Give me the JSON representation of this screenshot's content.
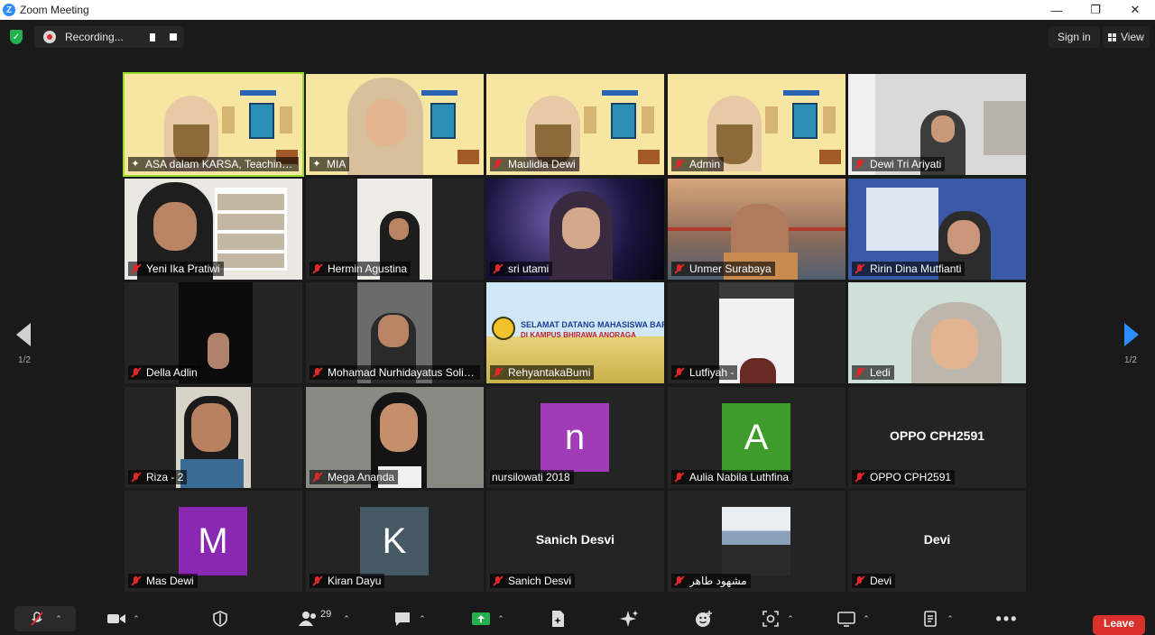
{
  "window": {
    "title": "Zoom Meeting",
    "minimize": "—",
    "restore": "❐",
    "close": "✕"
  },
  "topbar": {
    "recording_label": "Recording...",
    "signin_label": "Sign in",
    "view_label": "View"
  },
  "pager": {
    "prev_page": "1/2",
    "next_page": "1/2"
  },
  "participants": [
    {
      "name": "ASA dalam KARSA, Teaching I...",
      "kind": "video",
      "scene": "poster",
      "status": "pinned",
      "active": true
    },
    {
      "name": "MIA",
      "kind": "video",
      "scene": "poster-person",
      "status": "pinned"
    },
    {
      "name": "Maulidia Dewi",
      "kind": "video",
      "scene": "poster",
      "status": "muted"
    },
    {
      "name": "Admin",
      "kind": "video",
      "scene": "poster",
      "status": "muted"
    },
    {
      "name": "Dewi Tri Ariyati",
      "kind": "video",
      "scene": "room-light",
      "status": "muted"
    },
    {
      "name": "Yeni Ika Pratiwi",
      "kind": "video",
      "scene": "bookshelf",
      "status": "muted"
    },
    {
      "name": "Hermin Agustina",
      "kind": "video",
      "scene": "narrow-light",
      "status": "muted"
    },
    {
      "name": "sri utami",
      "kind": "video",
      "scene": "space",
      "status": "muted"
    },
    {
      "name": "Unmer Surabaya",
      "kind": "video",
      "scene": "bridge",
      "status": "muted"
    },
    {
      "name": "Ririn Dina Mutfianti",
      "kind": "video",
      "scene": "blue-poster",
      "status": "muted"
    },
    {
      "name": "Della Adlin",
      "kind": "video",
      "scene": "narrow-dark",
      "status": "muted"
    },
    {
      "name": "Mohamad Nurhidayatus Solik...",
      "kind": "video",
      "scene": "narrow-room",
      "status": "muted"
    },
    {
      "name": "RehyantakaBumi",
      "kind": "video",
      "scene": "banner",
      "banner_text": "SELAMAT DATANG MAHASISWA BARU",
      "banner_sub": "DI KAMPUS BHIRAWA ANORAGA",
      "status": "muted"
    },
    {
      "name": "Lutfiyah -",
      "kind": "video",
      "scene": "narrow-wall",
      "status": "muted"
    },
    {
      "name": "Ledi",
      "kind": "video",
      "scene": "headset",
      "status": "muted"
    },
    {
      "name": "Riza - 2",
      "kind": "video",
      "scene": "narrow-face",
      "status": "muted"
    },
    {
      "name": "Mega Ananda",
      "kind": "video",
      "scene": "face-dark",
      "status": "muted"
    },
    {
      "name": "nursilowati 2018",
      "kind": "avatar",
      "letter": "n",
      "color": "#a23bb8",
      "status": "none"
    },
    {
      "name": "Aulia Nabila Luthfina",
      "kind": "avatar",
      "letter": "A",
      "color": "#3e9d2a",
      "status": "muted"
    },
    {
      "name": "OPPO CPH2591",
      "kind": "nameonly",
      "status": "muted"
    },
    {
      "name": "Mas Dewi",
      "kind": "avatar",
      "letter": "M",
      "color": "#8a27b3",
      "status": "muted"
    },
    {
      "name": "Kiran Dayu",
      "kind": "avatar",
      "letter": "K",
      "color": "#465a66",
      "status": "muted"
    },
    {
      "name": "Sanich Desvi",
      "kind": "nameonly",
      "status": "muted"
    },
    {
      "name": "مشهود طاهر",
      "kind": "photo",
      "status": "muted"
    },
    {
      "name": "Devi",
      "kind": "nameonly",
      "status": "muted"
    }
  ],
  "toolbar": {
    "participant_count": "29",
    "leave_label": "Leave"
  }
}
